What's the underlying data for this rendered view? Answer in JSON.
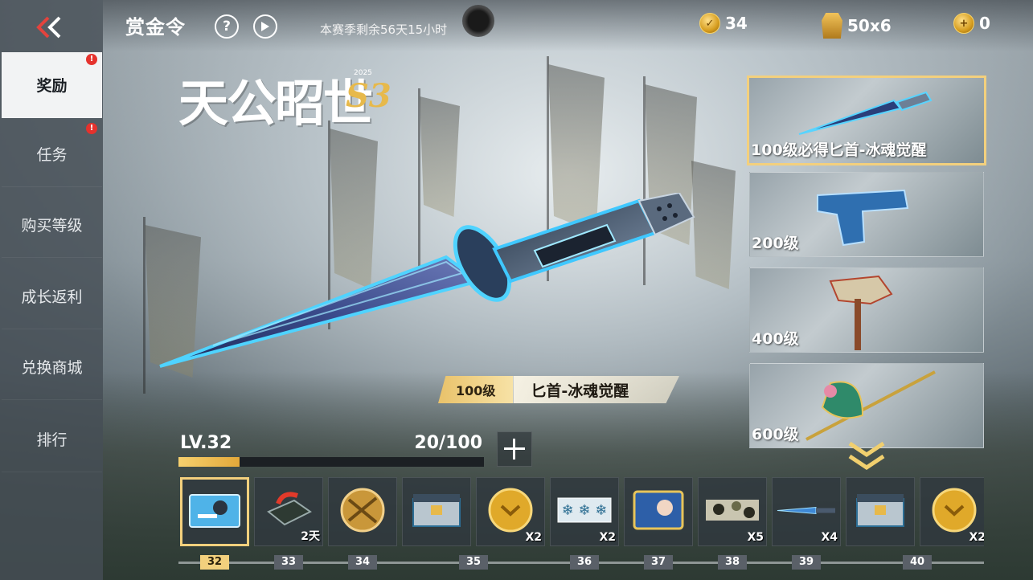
{
  "header": {
    "title": "赏金令",
    "help_icon": "question-circle-icon",
    "play_icon": "play-circle-icon",
    "season_remaining": "本赛季剩余56天15小时"
  },
  "currency": [
    {
      "name": "coin-currency",
      "icon": "gold-coin-icon",
      "value": "34"
    },
    {
      "name": "helmet-currency",
      "icon": "helmet-icon",
      "value": "50x6"
    },
    {
      "name": "token-currency",
      "icon": "token-coin-icon",
      "value": "0"
    }
  ],
  "sidebar": {
    "items": [
      {
        "label": "奖励",
        "active": true,
        "alert": true
      },
      {
        "label": "任务",
        "active": false,
        "alert": true
      },
      {
        "label": "购买等级",
        "active": false,
        "alert": false
      },
      {
        "label": "成长返利",
        "active": false,
        "alert": false
      },
      {
        "label": "兑换商城",
        "active": false,
        "alert": false
      },
      {
        "label": "排行",
        "active": false,
        "alert": false
      }
    ]
  },
  "logo": {
    "text": "天公昭世",
    "suffix": "S3",
    "year": "2025"
  },
  "featured": {
    "level": "100级",
    "name": "匕首-冰魂觉醒"
  },
  "level": {
    "label": "LV.32",
    "progress_text": "20/100",
    "progress_fraction": 0.2
  },
  "rewards_panel": [
    {
      "label": "100级必得匕首-冰魂觉醒",
      "selected": true,
      "icon": "dagger-icon"
    },
    {
      "label": "200级",
      "selected": false,
      "icon": "pistol-icon"
    },
    {
      "label": "400级",
      "selected": false,
      "icon": "axe-icon"
    },
    {
      "label": "600级",
      "selected": false,
      "icon": "halberd-icon"
    }
  ],
  "strip": [
    {
      "level": "32",
      "icon": "character-card-icon",
      "qty": "",
      "selected": true
    },
    {
      "level": "33",
      "icon": "weapon-crate-icon",
      "qty": "2天",
      "selected": false
    },
    {
      "level": "34",
      "icon": "rifle-medal-icon",
      "qty": "",
      "selected": false
    },
    {
      "level": "35",
      "icon": "supply-box-icon",
      "qty": "",
      "selected": false
    },
    {
      "level": "",
      "icon": "gold-coin-icon",
      "qty": "X2",
      "selected": false
    },
    {
      "level": "36",
      "icon": "snow-camo-card-icon",
      "qty": "X2",
      "selected": false
    },
    {
      "level": "37",
      "icon": "avatar-card-icon",
      "qty": "",
      "selected": false
    },
    {
      "level": "38",
      "icon": "camo-card-icon",
      "qty": "X5",
      "selected": false
    },
    {
      "level": "39",
      "icon": "blue-dagger-icon",
      "qty": "X4",
      "selected": false
    },
    {
      "level": "40",
      "icon": "supply-box-icon",
      "qty": "",
      "selected": false
    },
    {
      "level": "",
      "icon": "gold-coin-icon",
      "qty": "X2",
      "selected": false
    }
  ],
  "colors": {
    "accent_gold": "#f3d07d",
    "alert_red": "#e5322d",
    "sidebar_bg": "#46505a"
  }
}
